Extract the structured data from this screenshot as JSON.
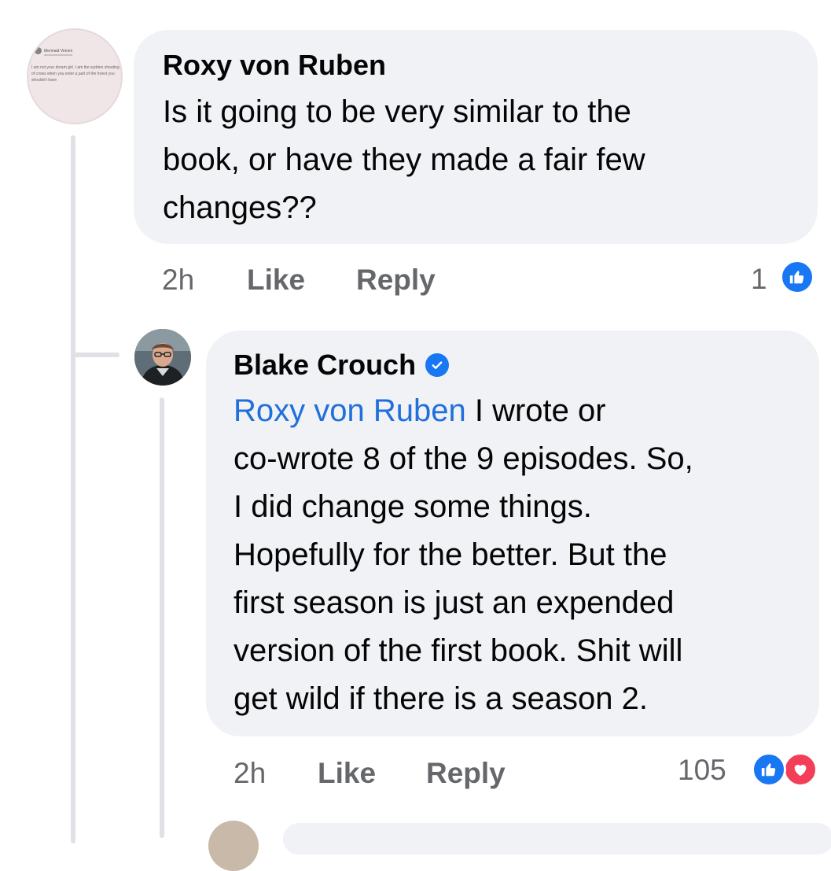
{
  "comment1": {
    "author": "Roxy von Ruben",
    "text_lines": [
      "Is it going to be very similar to the",
      "book, or have they made a fair few",
      "changes??"
    ],
    "time": "2h",
    "like_label": "Like",
    "reply_label": "Reply",
    "reaction_count": "1",
    "avatar_snippet": {
      "name": "Mermaid Venom",
      "text": "I am not your dream girl. I am the sudden shouting of crows when you enter a part of the forest you shouldn't have"
    }
  },
  "comment2": {
    "author": "Blake Crouch",
    "mention": "Roxy von Ruben",
    "text_after_mention": " I wrote or",
    "text_lines": [
      "co-wrote 8 of the 9 episodes. So,",
      "I did change some things.",
      "Hopefully for the better. But the",
      "first season is just an expended",
      "version of the first book. Shit will",
      "get wild if there is a season 2."
    ],
    "time": "2h",
    "like_label": "Like",
    "reply_label": "Reply",
    "reaction_count": "105"
  },
  "colors": {
    "bubble": "#f0f2f5",
    "meta": "#65676b",
    "mention": "#216fdb",
    "like_reaction": "#1877f2",
    "love_reaction": "#f33e58"
  },
  "icons": {
    "verified": "verified-badge-icon",
    "like": "like-reaction-icon",
    "love": "love-reaction-icon"
  }
}
